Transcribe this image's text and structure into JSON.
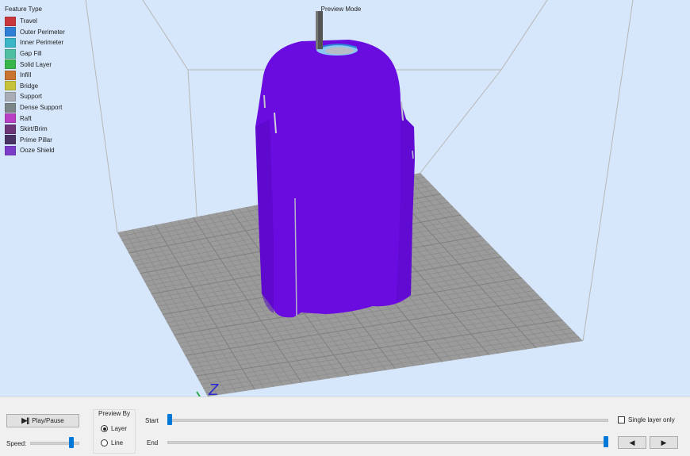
{
  "viewport": {
    "mode_label": "Preview Mode",
    "axis_label": "Z"
  },
  "legend": {
    "title": "Feature Type",
    "items": [
      {
        "label": "Travel",
        "color": "#c8373c"
      },
      {
        "label": "Outer Perimeter",
        "color": "#2f7fd6"
      },
      {
        "label": "Inner Perimeter",
        "color": "#3ab6c6"
      },
      {
        "label": "Gap Fill",
        "color": "#4fbfa2"
      },
      {
        "label": "Solid Layer",
        "color": "#38b64a"
      },
      {
        "label": "Infill",
        "color": "#c9742f"
      },
      {
        "label": "Bridge",
        "color": "#c6c23a"
      },
      {
        "label": "Support",
        "color": "#a8adb6"
      },
      {
        "label": "Dense Support",
        "color": "#7c8689"
      },
      {
        "label": "Raft",
        "color": "#b83fc4"
      },
      {
        "label": "Skirt/Brim",
        "color": "#6b3577"
      },
      {
        "label": "Prime Pillar",
        "color": "#4a3466"
      },
      {
        "label": "Ooze Shield",
        "color": "#7a3cc9"
      }
    ]
  },
  "model": {
    "color": "#6a0be0",
    "shade_color": "#5508c0"
  },
  "controls": {
    "play_pause_label": "Play/Pause",
    "play_icon": "▶||",
    "speed_label": "Speed:",
    "speed_level": 0.88,
    "preview_by_title": "Preview By",
    "preview_by_options": [
      {
        "label": "Layer",
        "selected": true
      },
      {
        "label": "Line",
        "selected": false
      }
    ],
    "start_label": "Start",
    "end_label": "End",
    "start_position": 0.0,
    "end_position": 1.0,
    "single_layer_label": "Single layer only",
    "single_layer_checked": false,
    "prev_icon": "◀",
    "next_icon": "▶"
  }
}
